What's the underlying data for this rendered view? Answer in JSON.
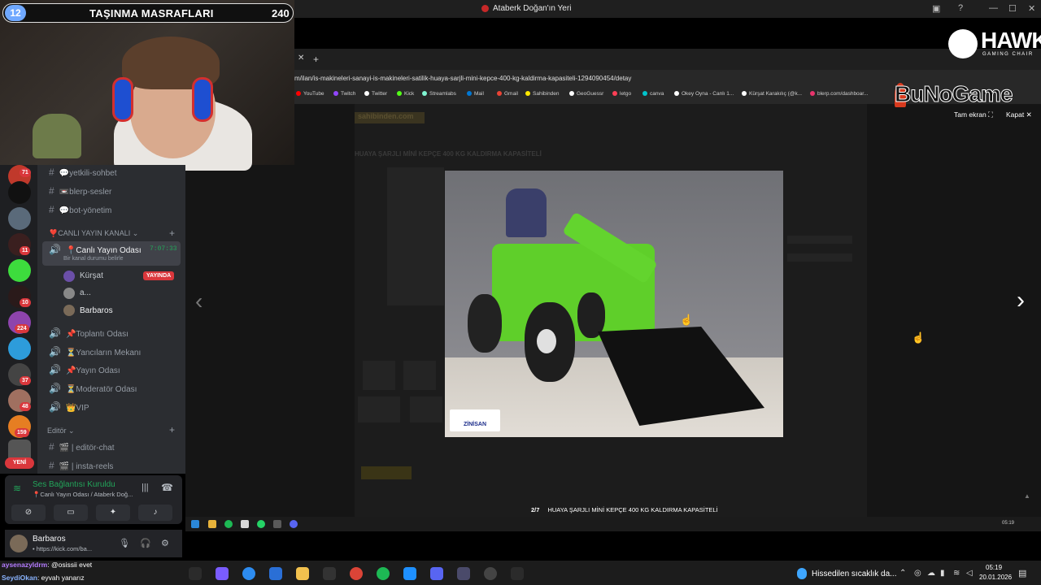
{
  "window": {
    "title": "Ataberk Doğan'ın Yeri"
  },
  "stream_overlay": {
    "badge_number": "12",
    "title": "TAŞINMA MASRAFLARI",
    "count": "240",
    "sponsor1": "HAWK",
    "sponsor1_sub": "GAMING CHAIR",
    "sponsor2": "BuNoGame"
  },
  "discord": {
    "server_badges": [
      "71",
      "11",
      "10",
      "224",
      "37",
      "48",
      "159"
    ],
    "new_label": "YENİ",
    "channels_top": [
      {
        "name": "💬yetkili-sohbet"
      },
      {
        "name": "📼blerp-sesler"
      },
      {
        "name": "💬bot-yönetim"
      }
    ],
    "category_live": "❣️CANLI YAYIN KANALI",
    "live_channel": {
      "name": "📍Canlı Yayın Odası",
      "timer": "7:07:33",
      "status_hint": "Bir kanal durumu belirle"
    },
    "voice_users": [
      {
        "name": "Kürşat",
        "badge": "YAYINDA"
      },
      {
        "name": "a..."
      },
      {
        "name": "Barbaros"
      }
    ],
    "voice_channels": [
      {
        "name": "📌Toplantı Odası"
      },
      {
        "name": "⏳Yancıların Mekanı"
      },
      {
        "name": "📌Yayın Odası"
      },
      {
        "name": "⏳Moderatör Odası"
      },
      {
        "name": "👑VIP"
      }
    ],
    "category_editor": "Editör",
    "editor_channels": [
      {
        "name": "🎬 | editör-chat"
      },
      {
        "name": "🎬 | insta-reels"
      }
    ],
    "voice_panel": {
      "status": "Ses Bağlantısı Kuruldu",
      "sub": "📍Canlı Yayın Odası / Ataberk Doğ..."
    },
    "user_panel": {
      "name": "Barbaros",
      "sub": "• https://kick.com/ba..."
    }
  },
  "chat": [
    {
      "user": "aysenazyldrm",
      "message": ": @osissii evet"
    },
    {
      "user": "SeydiOkan",
      "message": ": eyvah yanarız"
    }
  ],
  "browser": {
    "url": "m/ilan/is-makineleri-sanayi-is-makineleri-satilik-huaya-sarjli-mini-kepce-400-kg-kaldirma-kapasiteli-1294090454/detay",
    "bookmarks": [
      {
        "label": "YouTube",
        "color": "#ff0000"
      },
      {
        "label": "Twitch",
        "color": "#9146ff"
      },
      {
        "label": "Twitter",
        "color": "#ffffff"
      },
      {
        "label": "Kick",
        "color": "#53fc18"
      },
      {
        "label": "Streamlabs",
        "color": "#80f5d2"
      },
      {
        "label": "Mail",
        "color": "#0078d4"
      },
      {
        "label": "Gmail",
        "color": "#ea4335"
      },
      {
        "label": "Sahibinden",
        "color": "#ffe800"
      },
      {
        "label": "GeoGuessr",
        "color": "#ffffff"
      },
      {
        "label": "letgo",
        "color": "#ff3f55"
      },
      {
        "label": "canva",
        "color": "#00c4cc"
      },
      {
        "label": "Okey Oyna - Canlı 1...",
        "color": "#ffffff"
      },
      {
        "label": "Kürşat Karakılıç (@k...",
        "color": "#ffffff"
      },
      {
        "label": "blerp.com/dashboar...",
        "color": "#e8346c"
      }
    ],
    "tab_close": "✕",
    "tab_new": "+"
  },
  "listing": {
    "ghost_logo": "sahibinden.com",
    "ghost_title": "HUAYA ŞARJLI MİNİ KEPÇE 400 KG KALDIRMA KAPASİTELİ"
  },
  "lightbox": {
    "fullscreen_label": "Tam ekran ⛶",
    "close_label": "Kapat ✕",
    "counter": "2/7",
    "caption": "HUAYA ŞARJLI MİNİ KEPÇE 400 KG KALDIRMA KAPASİTELİ",
    "photo_logo": "ZİNİSAN"
  },
  "inner_taskbar": {
    "clock": "05:19"
  },
  "taskbar": {
    "weather": "Hissedilen sıcaklık da...",
    "time": "05:19",
    "date": "20.01.2026"
  }
}
